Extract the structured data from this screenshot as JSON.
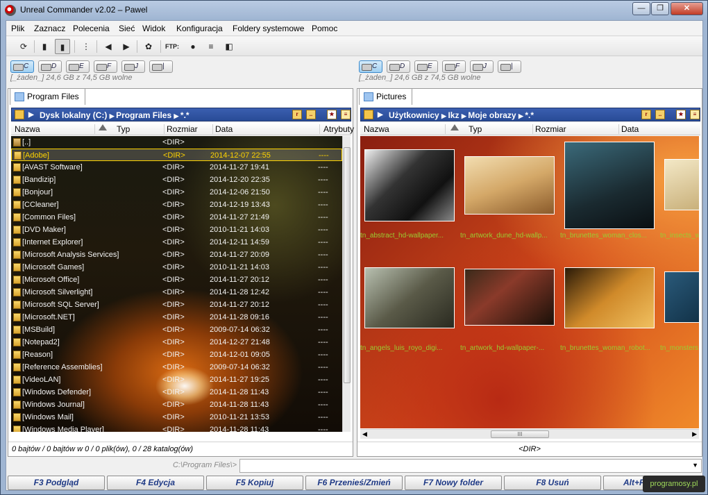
{
  "window": {
    "title": "Unreal Commander v2.02 – Pawel",
    "minimize": "—",
    "maximize": "❐",
    "close": "✕"
  },
  "menu": [
    "Plik",
    "Zaznacz",
    "Polecenia",
    "Sieć",
    "Widok",
    "Konfiguracja",
    "Foldery systemowe",
    "Pomoc"
  ],
  "toolbar": {
    "ftp_label": "FTP:"
  },
  "drives": [
    "C",
    "D",
    "E",
    "F",
    "J",
    "|"
  ],
  "left": {
    "free": "[_żaden_]  24,6 GB z  74,5 GB wolne",
    "tab": "Program Files",
    "path": [
      "Dysk lokalny (C:)",
      "Program Files",
      "*.*"
    ],
    "columns": [
      "Nazwa",
      "Typ",
      "Rozmiar",
      "Data",
      "Atrybuty"
    ],
    "rows": [
      {
        "name": "[..]",
        "size": "<DIR>",
        "date": "",
        "attr": ""
      },
      {
        "name": "[Adobe]",
        "size": "<DIR>",
        "date": "2014-12-07 22:55",
        "attr": "----"
      },
      {
        "name": "[AVAST Software]",
        "size": "<DIR>",
        "date": "2014-11-27 19:41",
        "attr": "----"
      },
      {
        "name": "[Bandizip]",
        "size": "<DIR>",
        "date": "2014-12-20 22:35",
        "attr": "----"
      },
      {
        "name": "[Bonjour]",
        "size": "<DIR>",
        "date": "2014-12-06 21:50",
        "attr": "----"
      },
      {
        "name": "[CCleaner]",
        "size": "<DIR>",
        "date": "2014-12-19 13:43",
        "attr": "----"
      },
      {
        "name": "[Common Files]",
        "size": "<DIR>",
        "date": "2014-11-27 21:49",
        "attr": "----"
      },
      {
        "name": "[DVD Maker]",
        "size": "<DIR>",
        "date": "2010-11-21 14:03",
        "attr": "----"
      },
      {
        "name": "[Internet Explorer]",
        "size": "<DIR>",
        "date": "2014-12-11 14:59",
        "attr": "----"
      },
      {
        "name": "[Microsoft Analysis Services]",
        "size": "<DIR>",
        "date": "2014-11-27 20:09",
        "attr": "----"
      },
      {
        "name": "[Microsoft Games]",
        "size": "<DIR>",
        "date": "2010-11-21 14:03",
        "attr": "----"
      },
      {
        "name": "[Microsoft Office]",
        "size": "<DIR>",
        "date": "2014-11-27 20:12",
        "attr": "----"
      },
      {
        "name": "[Microsoft Silverlight]",
        "size": "<DIR>",
        "date": "2014-11-28 12:42",
        "attr": "----"
      },
      {
        "name": "[Microsoft SQL Server]",
        "size": "<DIR>",
        "date": "2014-11-27 20:12",
        "attr": "----"
      },
      {
        "name": "[Microsoft.NET]",
        "size": "<DIR>",
        "date": "2014-11-28 09:16",
        "attr": "----"
      },
      {
        "name": "[MSBuild]",
        "size": "<DIR>",
        "date": "2009-07-14 06:32",
        "attr": "----"
      },
      {
        "name": "[Notepad2]",
        "size": "<DIR>",
        "date": "2014-12-27 21:48",
        "attr": "----"
      },
      {
        "name": "[Reason]",
        "size": "<DIR>",
        "date": "2014-12-01 09:05",
        "attr": "----"
      },
      {
        "name": "[Reference Assemblies]",
        "size": "<DIR>",
        "date": "2009-07-14 06:32",
        "attr": "----"
      },
      {
        "name": "[VideoLAN]",
        "size": "<DIR>",
        "date": "2014-11-27 19:25",
        "attr": "----"
      },
      {
        "name": "[Windows Defender]",
        "size": "<DIR>",
        "date": "2014-11-28 11:43",
        "attr": "----"
      },
      {
        "name": "[Windows Journal]",
        "size": "<DIR>",
        "date": "2014-11-28 11:43",
        "attr": "----"
      },
      {
        "name": "[Windows Mail]",
        "size": "<DIR>",
        "date": "2010-11-21 13:53",
        "attr": "----"
      },
      {
        "name": "[Windows Media Player]",
        "size": "<DIR>",
        "date": "2014-11-28 11:43",
        "attr": "----"
      }
    ],
    "status": "0 bajtów / 0 bajtów w 0 / 0 plik(ów), 0 / 28 katalog(ów)"
  },
  "right": {
    "free": "[_żaden_]  24,6 GB z  74,5 GB wolne",
    "tab": "Pictures",
    "path": [
      "Użytkownicy",
      "Ikz",
      "Moje obrazy",
      "*.*"
    ],
    "columns": [
      "Nazwa",
      "Typ",
      "Rozmiar",
      "Data"
    ],
    "thumbs": [
      "tn_abstract_hd-wallpaper...",
      "tn_artwork_dune_hd-wallp...",
      "tn_brunettes_woman_clos...",
      "tn_insects_w",
      "tn_angels_luis_royo_digi...",
      "tn_artwork_hd-wallpaper-...",
      "tn_brunettes_woman_robot...",
      "tn_monsters"
    ],
    "status": "<DIR>"
  },
  "cmdline": {
    "label": "C:\\Program Files\\>",
    "value": ""
  },
  "fkeys": [
    "F3 Podgląd",
    "F4 Edycja",
    "F5 Kopiuj",
    "F6 Przenieś/Zmień",
    "F7 Nowy folder",
    "F8 Usuń",
    "Alt+F4"
  ],
  "watermark": "programosy.pl"
}
